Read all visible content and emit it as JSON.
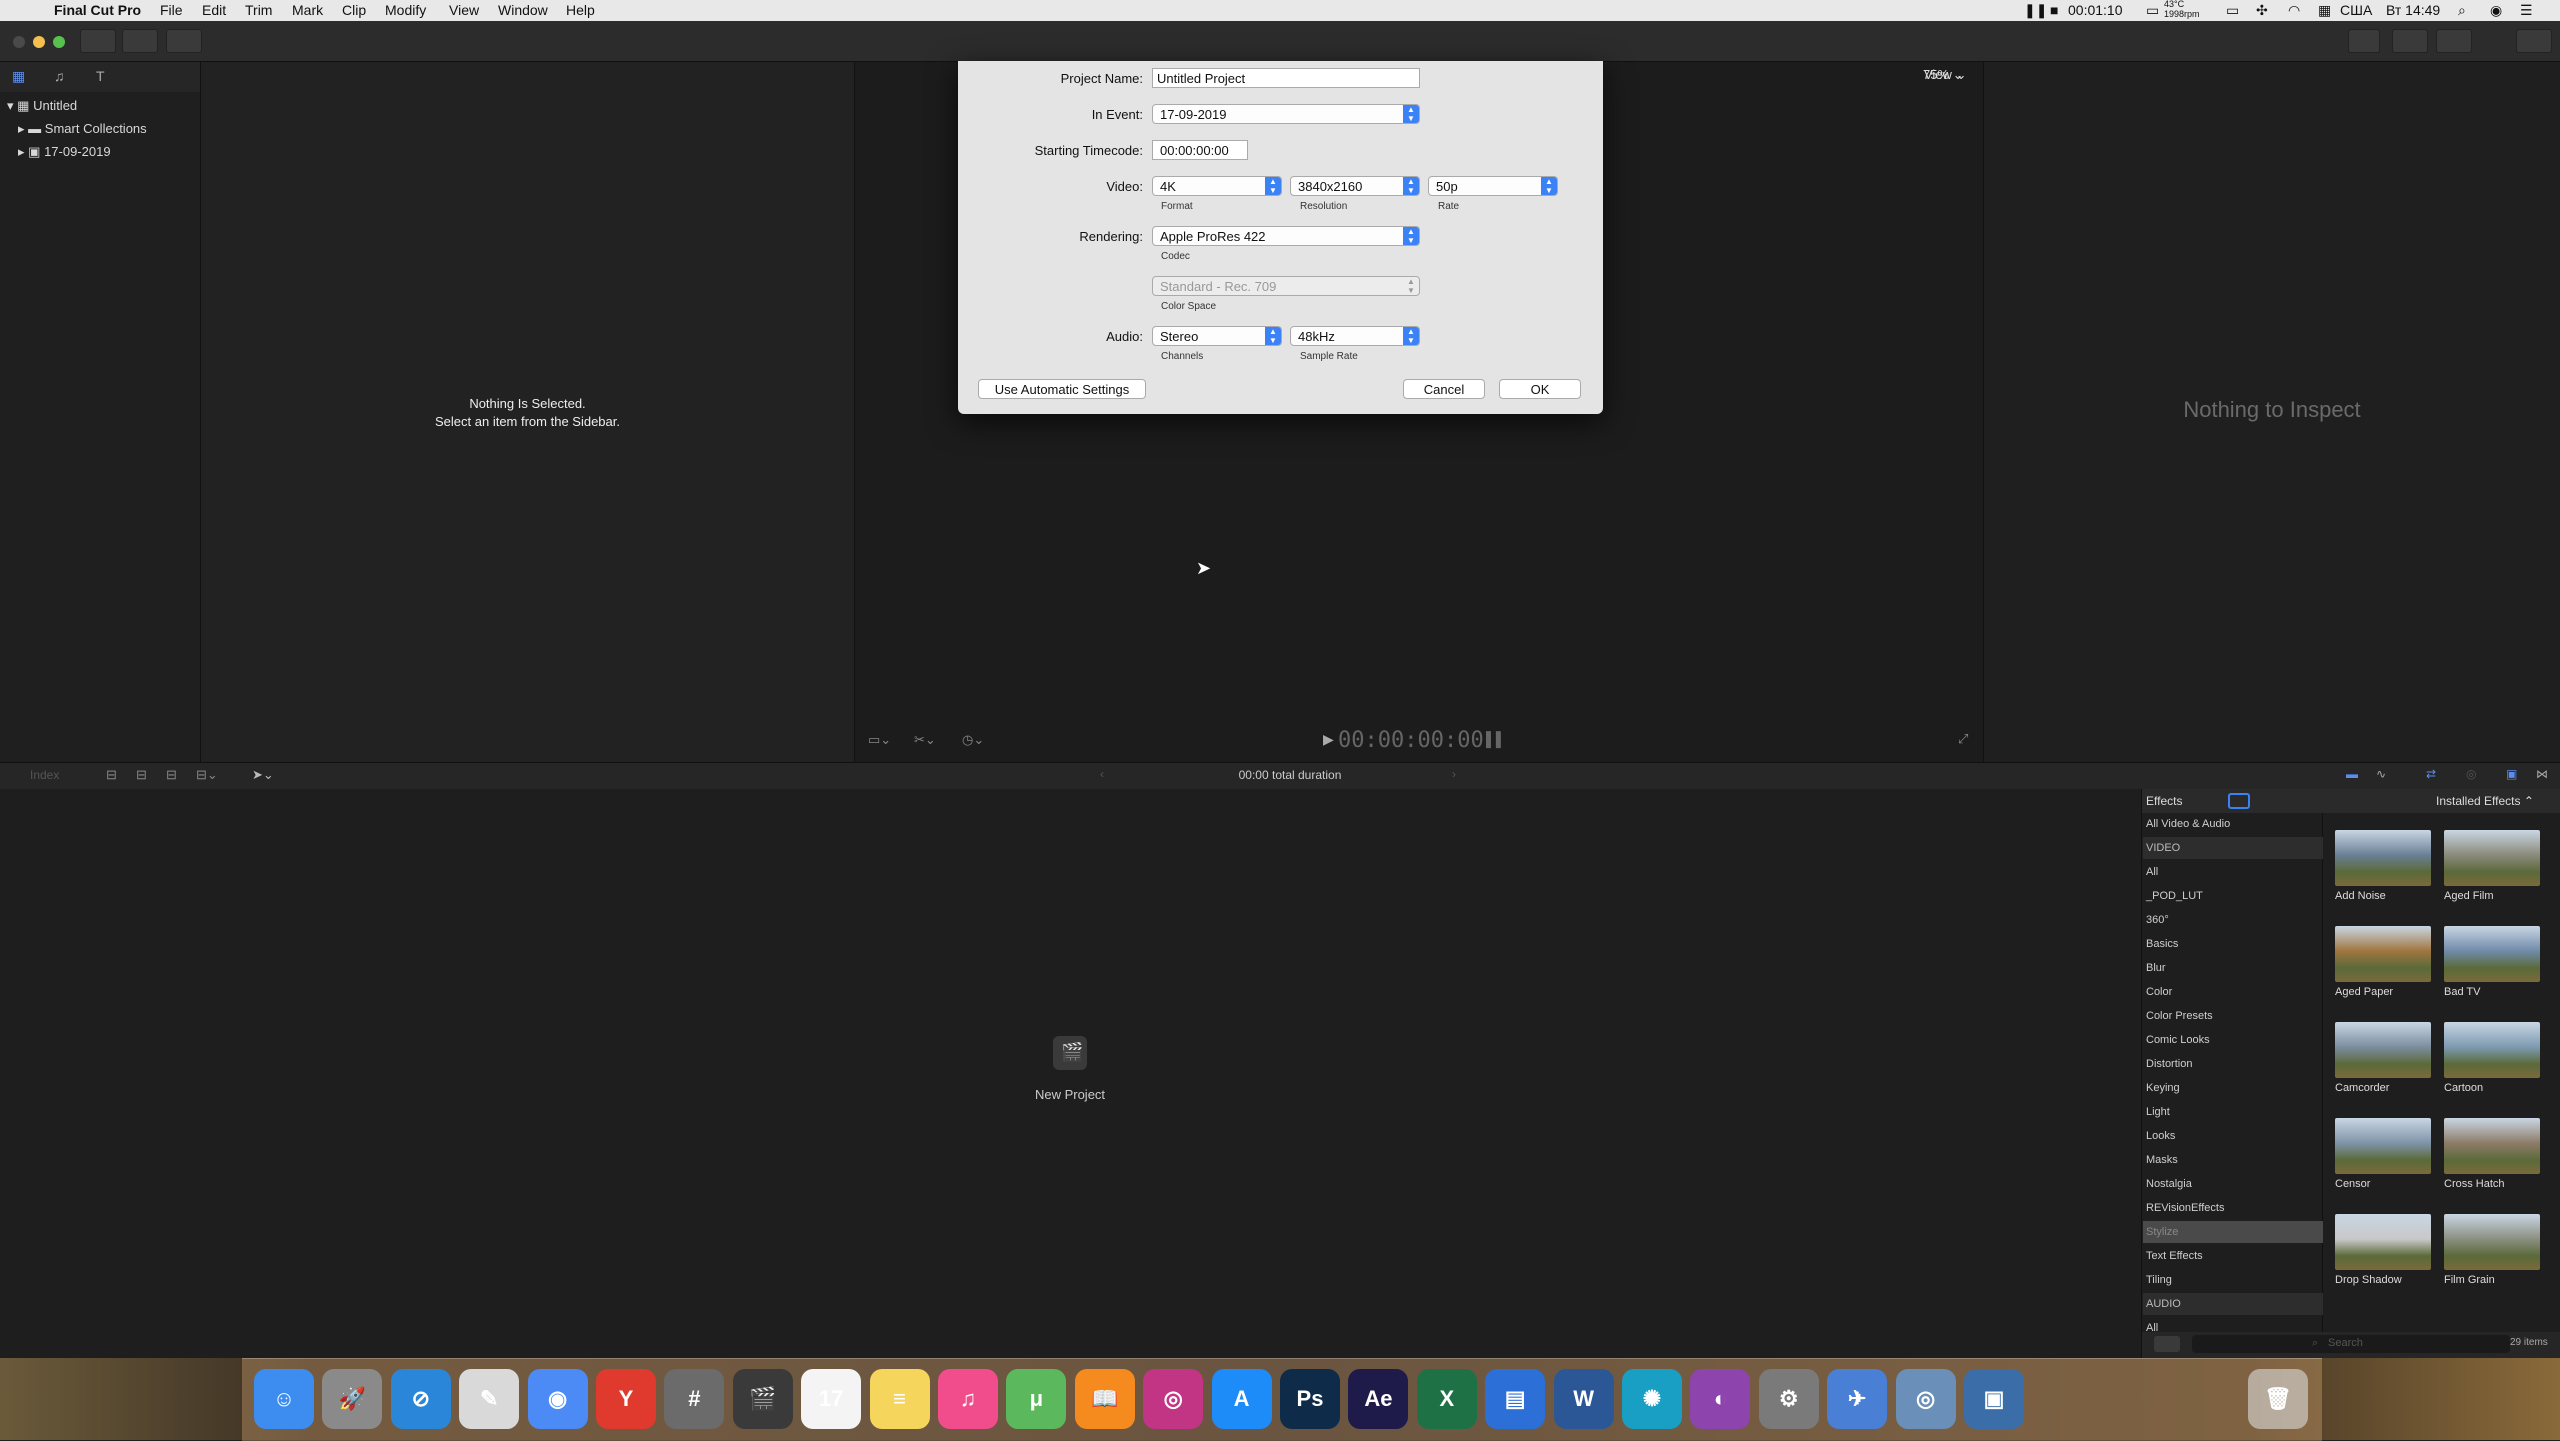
{
  "menubar": {
    "apple": "",
    "app_name": "Final Cut Pro",
    "items": [
      "File",
      "Edit",
      "Trim",
      "Mark",
      "Clip",
      "Modify",
      "View",
      "Window",
      "Help"
    ],
    "timer": "00:01:10",
    "temp": "43°C",
    "rpm": "1998rpm",
    "input_lang": "США",
    "clock": "Вт 14:49"
  },
  "browser_header": {
    "zoom": "75%",
    "view": "View"
  },
  "library": {
    "name": "Untitled",
    "items": [
      {
        "label": "Smart Collections"
      },
      {
        "label": "17-09-2019"
      }
    ]
  },
  "browser_empty": {
    "line1": "Nothing Is Selected.",
    "line2": "Select an item from the Sidebar."
  },
  "inspector": {
    "empty": "Nothing to Inspect"
  },
  "viewer": {
    "timecode": "00:00:00:00"
  },
  "timeline": {
    "index_label": "Index",
    "duration": "00:00 total duration",
    "new_project": "New Project"
  },
  "dialog": {
    "project_name_label": "Project Name:",
    "project_name_value": "Untitled Project",
    "in_event_label": "In Event:",
    "in_event_value": "17-09-2019",
    "timecode_label": "Starting Timecode:",
    "timecode_value": "00:00:00:00",
    "video_label": "Video:",
    "format_value": "4K",
    "format_caption": "Format",
    "resolution_value": "3840x2160",
    "resolution_caption": "Resolution",
    "rate_value": "50p",
    "rate_caption": "Rate",
    "rendering_label": "Rendering:",
    "codec_value": "Apple ProRes 422",
    "codec_caption": "Codec",
    "colorspace_value": "Standard - Rec. 709",
    "colorspace_caption": "Color Space",
    "audio_label": "Audio:",
    "channels_value": "Stereo",
    "channels_caption": "Channels",
    "samplerate_value": "48kHz",
    "samplerate_caption": "Sample Rate",
    "auto_button": "Use Automatic Settings",
    "cancel_button": "Cancel",
    "ok_button": "OK"
  },
  "effects": {
    "title": "Effects",
    "installed": "Installed Effects",
    "categories": [
      {
        "label": "All Video & Audio",
        "kind": "item"
      },
      {
        "label": "VIDEO",
        "kind": "header"
      },
      {
        "label": "All",
        "kind": "item"
      },
      {
        "label": "_POD_LUT",
        "kind": "item"
      },
      {
        "label": "360°",
        "kind": "item"
      },
      {
        "label": "Basics",
        "kind": "item"
      },
      {
        "label": "Blur",
        "kind": "item"
      },
      {
        "label": "Color",
        "kind": "item"
      },
      {
        "label": "Color Presets",
        "kind": "item"
      },
      {
        "label": "Comic Looks",
        "kind": "item"
      },
      {
        "label": "Distortion",
        "kind": "item"
      },
      {
        "label": "Keying",
        "kind": "item"
      },
      {
        "label": "Light",
        "kind": "item"
      },
      {
        "label": "Looks",
        "kind": "item"
      },
      {
        "label": "Masks",
        "kind": "item"
      },
      {
        "label": "Nostalgia",
        "kind": "item"
      },
      {
        "label": "REVisionEffects",
        "kind": "item"
      },
      {
        "label": "Stylize",
        "kind": "selected"
      },
      {
        "label": "Text Effects",
        "kind": "item"
      },
      {
        "label": "Tiling",
        "kind": "item"
      },
      {
        "label": "AUDIO",
        "kind": "header"
      },
      {
        "label": "All",
        "kind": "item"
      }
    ],
    "thumbs": [
      {
        "label": "Add Noise",
        "tone": "#6a7f95"
      },
      {
        "label": "Aged Film",
        "tone": "#8a8a7a"
      },
      {
        "label": "Aged Paper",
        "tone": "#a0753e"
      },
      {
        "label": "Bad TV",
        "tone": "#6f8aa8"
      },
      {
        "label": "Camcorder",
        "tone": "#7b8d9e"
      },
      {
        "label": "Cartoon",
        "tone": "#7c9ab0"
      },
      {
        "label": "Censor",
        "tone": "#7f93a8"
      },
      {
        "label": "Cross Hatch",
        "tone": "#8d7c68"
      },
      {
        "label": "Drop Shadow",
        "tone": "#c8c8c8"
      },
      {
        "label": "Film Grain",
        "tone": "#8a8f80"
      }
    ],
    "search_placeholder": "Search",
    "count": "29 items"
  },
  "dock": {
    "apps": [
      {
        "name": "finder",
        "color": "#3d8df0",
        "glyph": "☺"
      },
      {
        "name": "launchpad",
        "color": "#8a8a8a",
        "glyph": "🚀"
      },
      {
        "name": "safari",
        "color": "#2a86d8",
        "glyph": "⊘"
      },
      {
        "name": "textedit",
        "color": "#d9d9d9",
        "glyph": "✎"
      },
      {
        "name": "chrome",
        "color": "#4c8bf5",
        "glyph": "◉"
      },
      {
        "name": "yandex",
        "color": "#e03a2e",
        "glyph": "Y"
      },
      {
        "name": "calculator",
        "color": "#6b6b6b",
        "glyph": "#"
      },
      {
        "name": "final-cut-pro",
        "color": "#3a3a3a",
        "glyph": "🎬"
      },
      {
        "name": "calendar",
        "color": "#f4f4f4",
        "glyph": "17"
      },
      {
        "name": "notes",
        "color": "#f6d55c",
        "glyph": "≡"
      },
      {
        "name": "itunes",
        "color": "#f14d8c",
        "glyph": "♫"
      },
      {
        "name": "utorrent",
        "color": "#5cb85c",
        "glyph": "μ"
      },
      {
        "name": "books",
        "color": "#f58b1f",
        "glyph": "📖"
      },
      {
        "name": "instagram",
        "color": "#c13584",
        "glyph": "◎"
      },
      {
        "name": "app-store",
        "color": "#1d8cf8",
        "glyph": "A"
      },
      {
        "name": "photoshop",
        "color": "#0e2b4a",
        "glyph": "Ps"
      },
      {
        "name": "after-effects",
        "color": "#1e1b4a",
        "glyph": "Ae"
      },
      {
        "name": "excel",
        "color": "#1e7145",
        "glyph": "X"
      },
      {
        "name": "keynote",
        "color": "#2c6fd6",
        "glyph": "▤"
      },
      {
        "name": "word",
        "color": "#2b5797",
        "glyph": "W"
      },
      {
        "name": "chatgpt",
        "color": "#1a9fc4",
        "glyph": "✺"
      },
      {
        "name": "podcasts",
        "color": "#8e44ad",
        "glyph": "◐"
      },
      {
        "name": "system-preferences",
        "color": "#7a7a7a",
        "glyph": "⚙"
      },
      {
        "name": "clipboard",
        "color": "#4a7fd6",
        "glyph": "✈"
      },
      {
        "name": "screenshot",
        "color": "#6a8fb8",
        "glyph": "◎"
      },
      {
        "name": "preview",
        "color": "#3b6ea8",
        "glyph": "▣"
      }
    ]
  }
}
